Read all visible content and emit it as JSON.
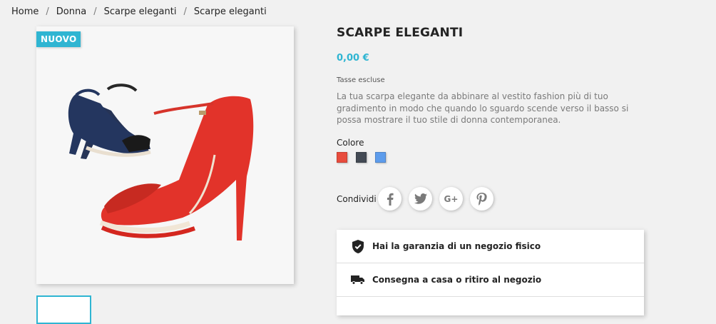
{
  "breadcrumb": [
    {
      "label": "Home"
    },
    {
      "label": "Donna"
    },
    {
      "label": "Scarpe eleganti"
    },
    {
      "label": "Scarpe eleganti"
    }
  ],
  "product": {
    "badge": "NUOVO",
    "title": "SCARPE ELEGANTI",
    "price": "0,00 €",
    "tax_note": "Tasse escluse",
    "description": "La tua scarpa elegante da abbinare al vestito fashion più di tuo gradimento in modo che quando lo sguardo scende verso il basso si possa mostrare il tuo stile di donna contemporanea.",
    "image_alt": "red-and-navy-heel-sandals"
  },
  "variants": {
    "label": "Colore",
    "colors": [
      {
        "name": "red",
        "hex": "#e84c3d"
      },
      {
        "name": "dark-grey",
        "hex": "#434a54"
      },
      {
        "name": "blue",
        "hex": "#5d9cec"
      }
    ]
  },
  "share": {
    "label": "Condividi",
    "buttons": [
      {
        "name": "facebook-icon"
      },
      {
        "name": "twitter-icon"
      },
      {
        "name": "google-plus-icon",
        "glyph": "G+"
      },
      {
        "name": "pinterest-icon"
      }
    ]
  },
  "reassurance": [
    {
      "icon": "shield-check-icon",
      "text": "Hai la garanzia di un negozio fisico"
    },
    {
      "icon": "truck-icon",
      "text": "Consegna a casa o ritiro al negozio"
    }
  ],
  "colors": {
    "accent": "#2fb5d2",
    "background": "#f1f1f1",
    "text": "#232323",
    "muted": "#7a7a7a"
  }
}
